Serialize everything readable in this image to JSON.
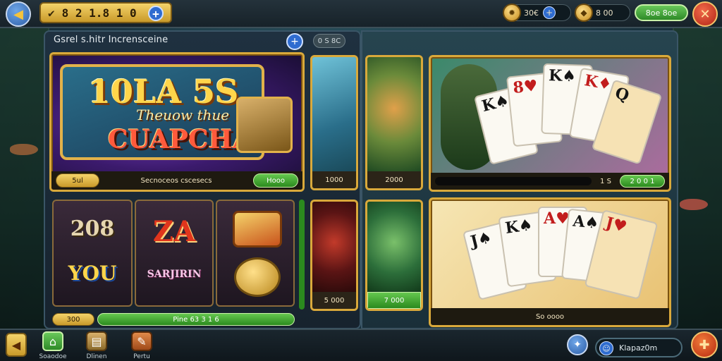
{
  "topbar": {
    "balance": "8 2 1.8  1 0",
    "currency1": "30€",
    "currency2": "8 00",
    "shop_label": "8oe 8oe"
  },
  "panel": {
    "title": "Gsrel s.hitr Incrensceine",
    "tag": "0 S 8C"
  },
  "featured": {
    "logo_line1": "10LA 5S",
    "logo_line2": "Theuow thue",
    "logo_line3": "CUAPCHA",
    "left_pill": "5ul",
    "caption": "Secnoceos cscesecs",
    "right_pill": "Hooo"
  },
  "tiles": {
    "waterfall_value": "1000",
    "slot1_top": "208",
    "slot1_bottom": "YOU",
    "slot2_top": "ZA",
    "slot2_bottom": "SARJIRIN",
    "bottom_left_pill": "300",
    "bottom_caption": "Pine 63 3 1 6",
    "fish_value": "5 000"
  },
  "right": {
    "tile1_value": "2000",
    "tile2_value": "7 000",
    "cards1_caption": "1 S",
    "cards1_pill": "2 0 0 1",
    "cards2_caption": "So oooo"
  },
  "bottombar": {
    "nav": [
      "Soaodoe",
      "Dlinen",
      "Pertu"
    ],
    "search_value": "Klapaz0m"
  },
  "colors": {
    "accent_gold": "#d9a93b",
    "accent_green": "#2b8a1e",
    "accent_blue": "#2f6cd0",
    "close_red": "#b32416"
  },
  "icons": {
    "back": "back-arrow-icon",
    "close": "close-icon",
    "info": "plus-icon",
    "search": "person-icon"
  }
}
